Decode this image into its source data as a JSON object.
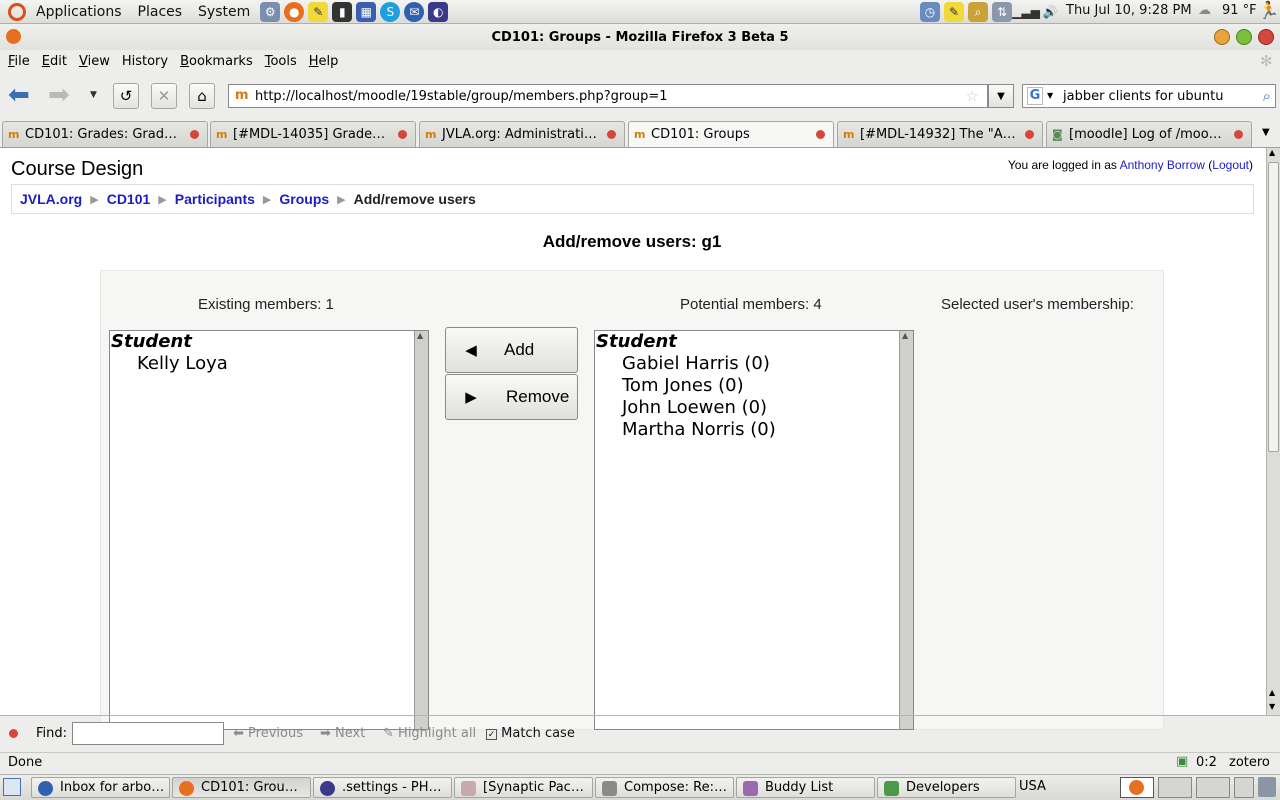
{
  "top_panel": {
    "menus": [
      "Applications",
      "Places",
      "System"
    ],
    "clock": "Thu Jul 10,  9:28 PM",
    "weather": "91 °F"
  },
  "window": {
    "title": "CD101: Groups - Mozilla Firefox 3 Beta 5"
  },
  "menubar": [
    {
      "label": "File",
      "key": "F",
      "rest": "ile"
    },
    {
      "label": "Edit",
      "key": "E",
      "rest": "dit"
    },
    {
      "label": "View",
      "key": "V",
      "rest": "iew"
    },
    {
      "label": "History",
      "key": "",
      "rest": "History"
    },
    {
      "label": "Bookmarks",
      "key": "B",
      "rest": "ookmarks"
    },
    {
      "label": "Tools",
      "key": "T",
      "rest": "ools"
    },
    {
      "label": "Help",
      "key": "H",
      "rest": "elp"
    }
  ],
  "navbar": {
    "url": "http://localhost/moodle/19stable/group/members.php?group=1",
    "search": "jabber clients for ubuntu"
  },
  "tabs": [
    "CD101: Grades: Grad…",
    "[#MDL-14035] Grade…",
    "JVLA.org: Administrati…",
    "CD101: Groups",
    "[#MDL-14932] The \"A…",
    "[moodle] Log of /moo…"
  ],
  "page": {
    "course_title": "Course Design",
    "login_prefix": "You are logged in as ",
    "login_user": "Anthony Borrow",
    "login_logout": "Logout",
    "breadcrumb": [
      "JVLA.org",
      "CD101",
      "Participants",
      "Groups"
    ],
    "breadcrumb_current": "Add/remove users",
    "heading": "Add/remove users: g1",
    "existing_label": "Existing members: 1",
    "potential_label": "Potential members: 4",
    "membership_label": "Selected user's membership:",
    "existing_group": "Student",
    "existing_members": [
      "Kelly Loya"
    ],
    "potential_group": "Student",
    "potential_members": [
      "Gabiel Harris (0)",
      "Tom Jones (0)",
      "John Loewen (0)",
      "Martha Norris (0)"
    ],
    "add_button": "Add",
    "remove_button": "Remove",
    "add_arrow": "◀",
    "remove_arrow": "▶"
  },
  "findbar": {
    "label": "Find:",
    "previous": "Previous",
    "next": "Next",
    "highlight": "Highlight all",
    "match_case": "Match case"
  },
  "statusbar": {
    "text": "Done",
    "counter": "0:2",
    "zotero": "zotero"
  },
  "taskbar": [
    "Inbox for arbo…",
    "CD101: Grou…",
    ".settings - PH…",
    "[Synaptic Pac…",
    "Compose: Re:…",
    "Buddy List",
    "Developers"
  ],
  "keyboard_layout": "USA",
  "colors": {
    "link": "#1c1cc6",
    "close_dot": "#d5473a",
    "moodle_icon": "#d97b0a"
  }
}
